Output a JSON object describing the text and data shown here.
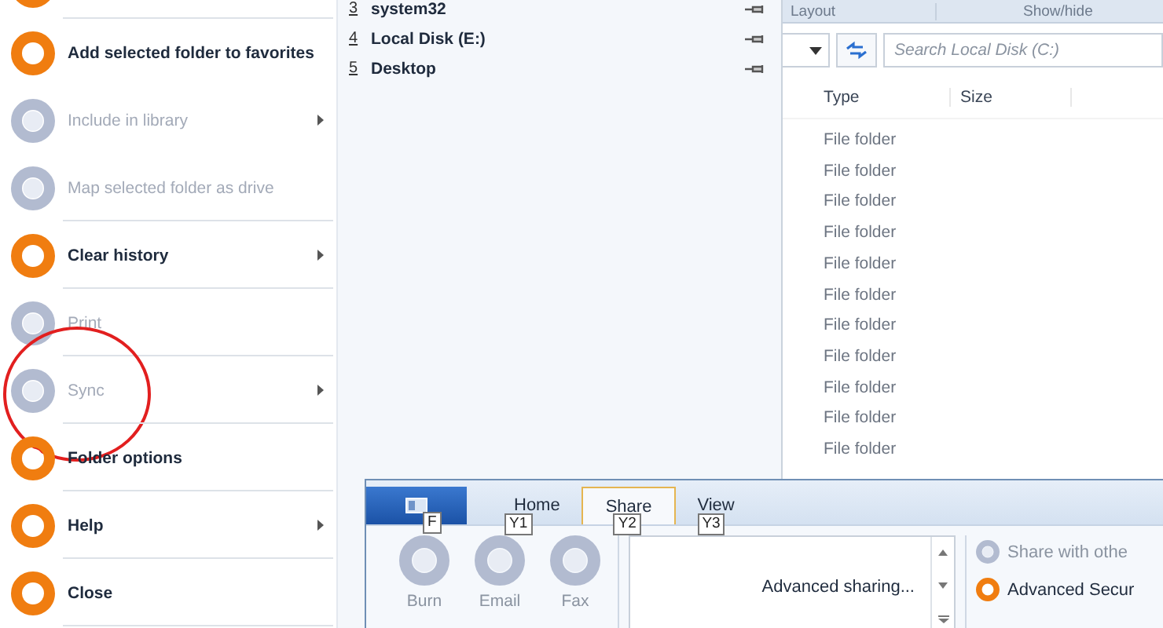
{
  "file_menu": {
    "items": [
      {
        "enabled": true,
        "separator_after": true
      },
      {
        "label": "Add selected folder to favorites",
        "enabled": true,
        "submenu": false,
        "separator_after": false
      },
      {
        "label": "Include in library",
        "enabled": false,
        "submenu": true,
        "separator_after": false
      },
      {
        "label": "Map selected folder as drive",
        "enabled": false,
        "submenu": false,
        "separator_after": true
      },
      {
        "label": "Clear history",
        "enabled": true,
        "submenu": true,
        "separator_after": true
      },
      {
        "label": "Print",
        "enabled": false,
        "submenu": false,
        "separator_after": true
      },
      {
        "label": "Sync",
        "enabled": false,
        "submenu": true,
        "separator_after": true,
        "circled": true
      },
      {
        "label": "Folder options",
        "enabled": true,
        "submenu": false,
        "separator_after": true
      },
      {
        "label": "Help",
        "enabled": true,
        "submenu": true,
        "separator_after": true
      },
      {
        "label": "Close",
        "enabled": true,
        "submenu": false,
        "separator_after": true
      }
    ]
  },
  "frequent_places": [
    {
      "number": "3",
      "name": "system32"
    },
    {
      "number": "4",
      "name": "Local Disk (E:)"
    },
    {
      "number": "5",
      "name": "Desktop"
    }
  ],
  "ribbon_groups": [
    "Layout",
    "Show/hide"
  ],
  "search": {
    "placeholder": "Search Local Disk (C:)"
  },
  "file_list": {
    "columns": [
      "Type",
      "Size"
    ],
    "rows": [
      "File folder",
      "File folder",
      "File folder",
      "File folder",
      "File folder",
      "File folder",
      "File folder",
      "File folder",
      "File folder",
      "File folder",
      "File folder"
    ]
  },
  "ribbon": {
    "tabs": [
      {
        "kind": "file",
        "keytip": "F",
        "selected": false
      },
      {
        "label": "Home",
        "kind": "tab",
        "keytip": "Y1",
        "selected": false
      },
      {
        "label": "Share",
        "kind": "tab",
        "keytip": "Y2",
        "selected": true
      },
      {
        "label": "View",
        "kind": "tab",
        "keytip": "Y3",
        "selected": false
      }
    ],
    "send_buttons": [
      {
        "label": "Burn",
        "enabled": false
      },
      {
        "label": "Email",
        "enabled": false
      },
      {
        "label": "Fax",
        "enabled": false
      }
    ],
    "share_list": {
      "value": "Advanced sharing..."
    },
    "options": [
      {
        "label": "Share with othe",
        "enabled": false
      },
      {
        "label": "Advanced Secur",
        "enabled": true
      }
    ]
  }
}
